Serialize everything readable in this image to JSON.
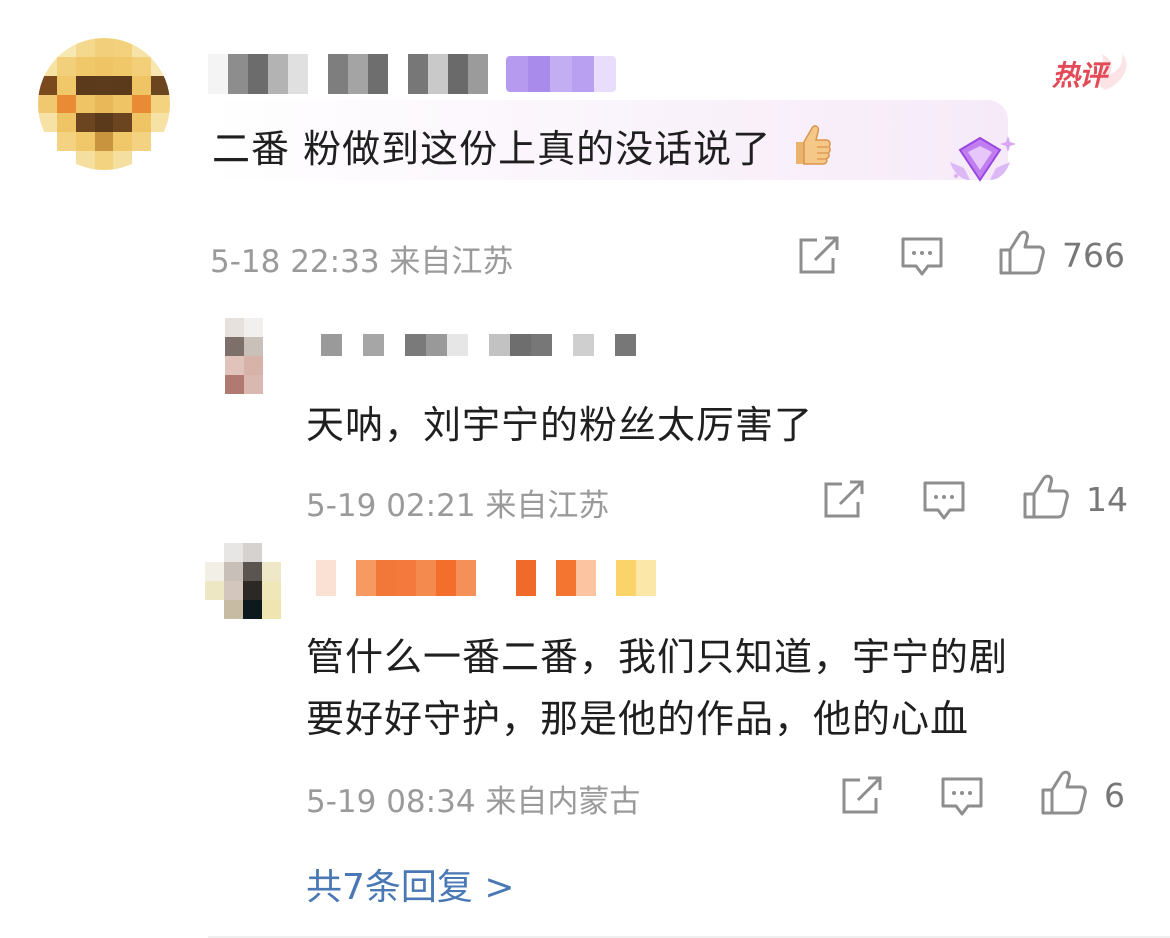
{
  "hot_badge": "热评",
  "colors": {
    "meta": "#9a9a9a",
    "link": "#4a78b4",
    "badge": "#e34a58",
    "highlight": "#f6eaf8"
  },
  "main_comment": {
    "text": "二番 粉做到这份上真的没话说了",
    "emoji": "thumbs-up-emoji",
    "time": "5-18 22:33",
    "location": "来自江苏",
    "likes": "766"
  },
  "replies": [
    {
      "text": "天呐，刘宇宁的粉丝太厉害了",
      "time": "5-19 02:21",
      "location": "来自江苏",
      "likes": "14"
    },
    {
      "text_line1": "管什么一番二番，我们只知道，宇宁的剧",
      "text_line2": "要好好守护，那是他的作品，他的心血",
      "time": "5-19 08:34",
      "location": "来自内蒙古",
      "likes": "6"
    }
  ],
  "more_replies": "共7条回复 >"
}
